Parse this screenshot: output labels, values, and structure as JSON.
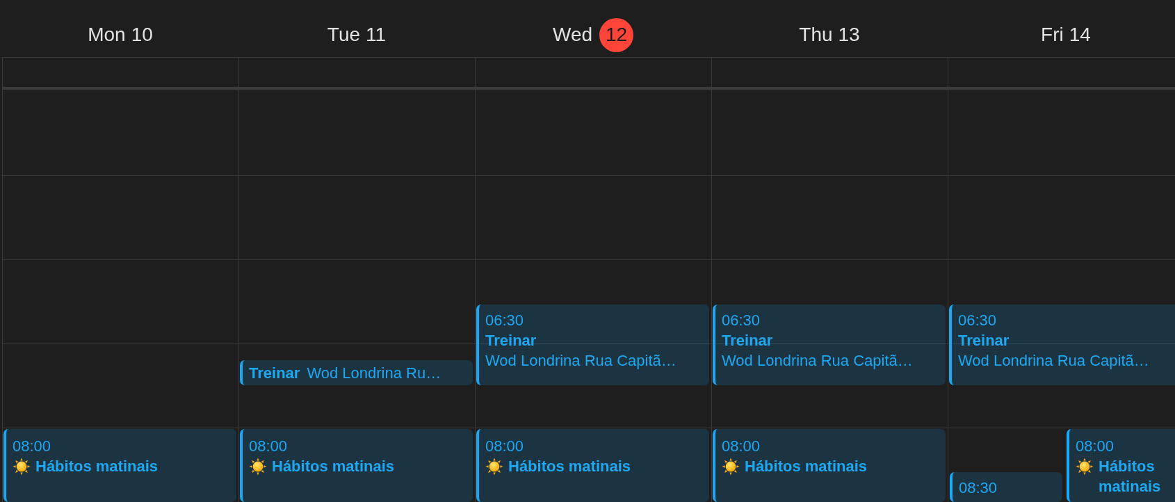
{
  "days": [
    {
      "weekday": "Mon",
      "date": "10",
      "today": false,
      "events": [
        {
          "kind": "habit",
          "time": "08:00",
          "title": "Hábitos matinais"
        }
      ]
    },
    {
      "weekday": "Tue",
      "date": "11",
      "today": false,
      "events": [
        {
          "kind": "compact",
          "title": "Treinar",
          "location": "Wod Londrina Ru…"
        },
        {
          "kind": "habit",
          "time": "08:00",
          "title": "Hábitos matinais"
        }
      ]
    },
    {
      "weekday": "Wed",
      "date": "12",
      "today": true,
      "events": [
        {
          "kind": "timed",
          "time": "06:30",
          "title": "Treinar",
          "location": "Wod Londrina Rua Capitã…"
        },
        {
          "kind": "habit",
          "time": "08:00",
          "title": "Hábitos matinais"
        }
      ]
    },
    {
      "weekday": "Thu",
      "date": "13",
      "today": false,
      "events": [
        {
          "kind": "timed",
          "time": "06:30",
          "title": "Treinar",
          "location": "Wod Londrina Rua Capitã…"
        },
        {
          "kind": "habit",
          "time": "08:00",
          "title": "Hábitos matinais"
        }
      ]
    },
    {
      "weekday": "Fri",
      "date": "14",
      "today": false,
      "events": [
        {
          "kind": "timed",
          "time": "06:30",
          "title": "Treinar",
          "location": "Wod Londrina Rua Capitã…"
        },
        {
          "kind": "timed",
          "time": "08:30"
        },
        {
          "kind": "habit",
          "time": "08:00",
          "title": "Hábitos matinais"
        }
      ]
    }
  ]
}
